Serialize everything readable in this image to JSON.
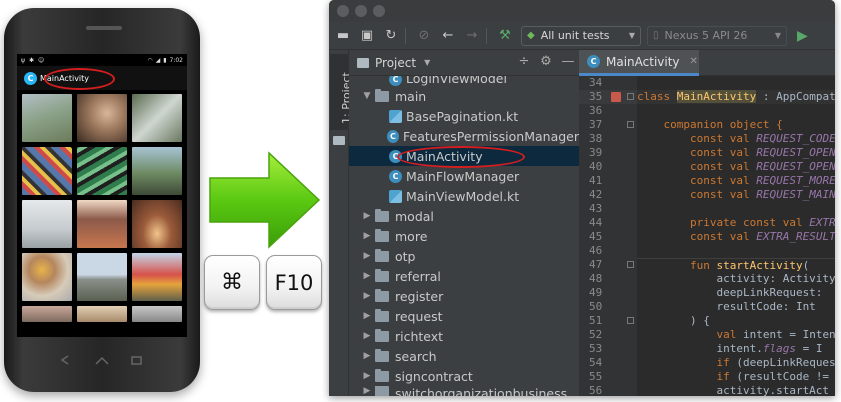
{
  "phone": {
    "time": "7:02",
    "app_title": "MainActivity",
    "app_logo_glyph": "C"
  },
  "keys": {
    "cmd": "⌘",
    "f10": "F10"
  },
  "toolbar": {
    "run_config": "All unit tests",
    "device": "Nexus 5 API 26"
  },
  "sidebar": {
    "tab_label": "1: Project"
  },
  "project_panel": {
    "title": "Project",
    "tree": [
      {
        "label": "LoginViewModel",
        "type": "class",
        "indent": 3,
        "partial": "top"
      },
      {
        "label": "main",
        "type": "folder",
        "indent": 1,
        "expanded": true
      },
      {
        "label": "BasePagination.kt",
        "type": "kotlin",
        "indent": 3
      },
      {
        "label": "FeaturesPermissionManager",
        "type": "class",
        "indent": 3
      },
      {
        "label": "MainActivity",
        "type": "class",
        "indent": 3,
        "selected": true
      },
      {
        "label": "MainFlowManager",
        "type": "class",
        "indent": 3
      },
      {
        "label": "MainViewModel.kt",
        "type": "kotlin",
        "indent": 3
      },
      {
        "label": "modal",
        "type": "folder",
        "indent": 1
      },
      {
        "label": "more",
        "type": "folder",
        "indent": 1
      },
      {
        "label": "otp",
        "type": "folder",
        "indent": 1
      },
      {
        "label": "referral",
        "type": "folder",
        "indent": 1
      },
      {
        "label": "register",
        "type": "folder",
        "indent": 1
      },
      {
        "label": "request",
        "type": "folder",
        "indent": 1
      },
      {
        "label": "richtext",
        "type": "folder",
        "indent": 1
      },
      {
        "label": "search",
        "type": "folder",
        "indent": 1
      },
      {
        "label": "signcontract",
        "type": "folder",
        "indent": 1
      },
      {
        "label": "switchorganizationbusiness",
        "type": "folder",
        "indent": 1,
        "partial": "bottom"
      }
    ]
  },
  "editor": {
    "tab_label": "MainActivity",
    "gutter": [
      "34",
      "35",
      "36",
      "37",
      "38",
      "39",
      "40",
      "41",
      "42",
      "43",
      "44",
      "45",
      "46",
      "47",
      "48",
      "49",
      "50",
      "51",
      "52",
      "53",
      "54",
      "55",
      "56"
    ],
    "lines": [
      [],
      [
        {
          "t": "class ",
          "c": "kw"
        },
        {
          "t": "MainActivity",
          "c": "hl"
        },
        {
          "t": " : AppCompatActivity",
          "c": ""
        }
      ],
      [],
      [
        {
          "t": "    companion object {",
          "c": "kw"
        }
      ],
      [
        {
          "t": "        const val ",
          "c": "kw"
        },
        {
          "t": "REQUEST_CODE",
          "c": "cn"
        }
      ],
      [
        {
          "t": "        const val ",
          "c": "kw"
        },
        {
          "t": "REQUEST_OPEN",
          "c": "cn"
        }
      ],
      [
        {
          "t": "        const val ",
          "c": "kw"
        },
        {
          "t": "REQUEST_OPEN",
          "c": "cn"
        }
      ],
      [
        {
          "t": "        const val ",
          "c": "kw"
        },
        {
          "t": "REQUEST_MORE",
          "c": "cn"
        }
      ],
      [
        {
          "t": "        const val ",
          "c": "kw"
        },
        {
          "t": "REQUEST_MAIN",
          "c": "cn"
        }
      ],
      [],
      [
        {
          "t": "        private const val ",
          "c": "kw"
        },
        {
          "t": "EXTRA",
          "c": "cn"
        }
      ],
      [
        {
          "t": "        const val ",
          "c": "kw"
        },
        {
          "t": "EXTRA_RESULT",
          "c": "cn"
        }
      ],
      [],
      [
        {
          "t": "        fun ",
          "c": "kw"
        },
        {
          "t": "startActivity",
          "c": "fn"
        },
        {
          "t": "(",
          "c": ""
        }
      ],
      [
        {
          "t": "            activity: Activity",
          "c": ""
        }
      ],
      [
        {
          "t": "            deepLinkRequest:",
          "c": ""
        }
      ],
      [
        {
          "t": "            resultCode: Int",
          "c": ""
        }
      ],
      [
        {
          "t": "        ) {",
          "c": ""
        }
      ],
      [
        {
          "t": "            val ",
          "c": "kw"
        },
        {
          "t": "intent = Intent",
          "c": ""
        }
      ],
      [
        {
          "t": "            intent.",
          "c": ""
        },
        {
          "t": "flags",
          "c": "it"
        },
        {
          "t": " = I",
          "c": ""
        }
      ],
      [
        {
          "t": "            if ",
          "c": "kw"
        },
        {
          "t": "(deepLinkRequest",
          "c": ""
        }
      ],
      [
        {
          "t": "            if ",
          "c": "kw"
        },
        {
          "t": "(resultCode != ",
          "c": ""
        }
      ],
      [
        {
          "t": "            activity.startAct",
          "c": ""
        }
      ]
    ]
  }
}
